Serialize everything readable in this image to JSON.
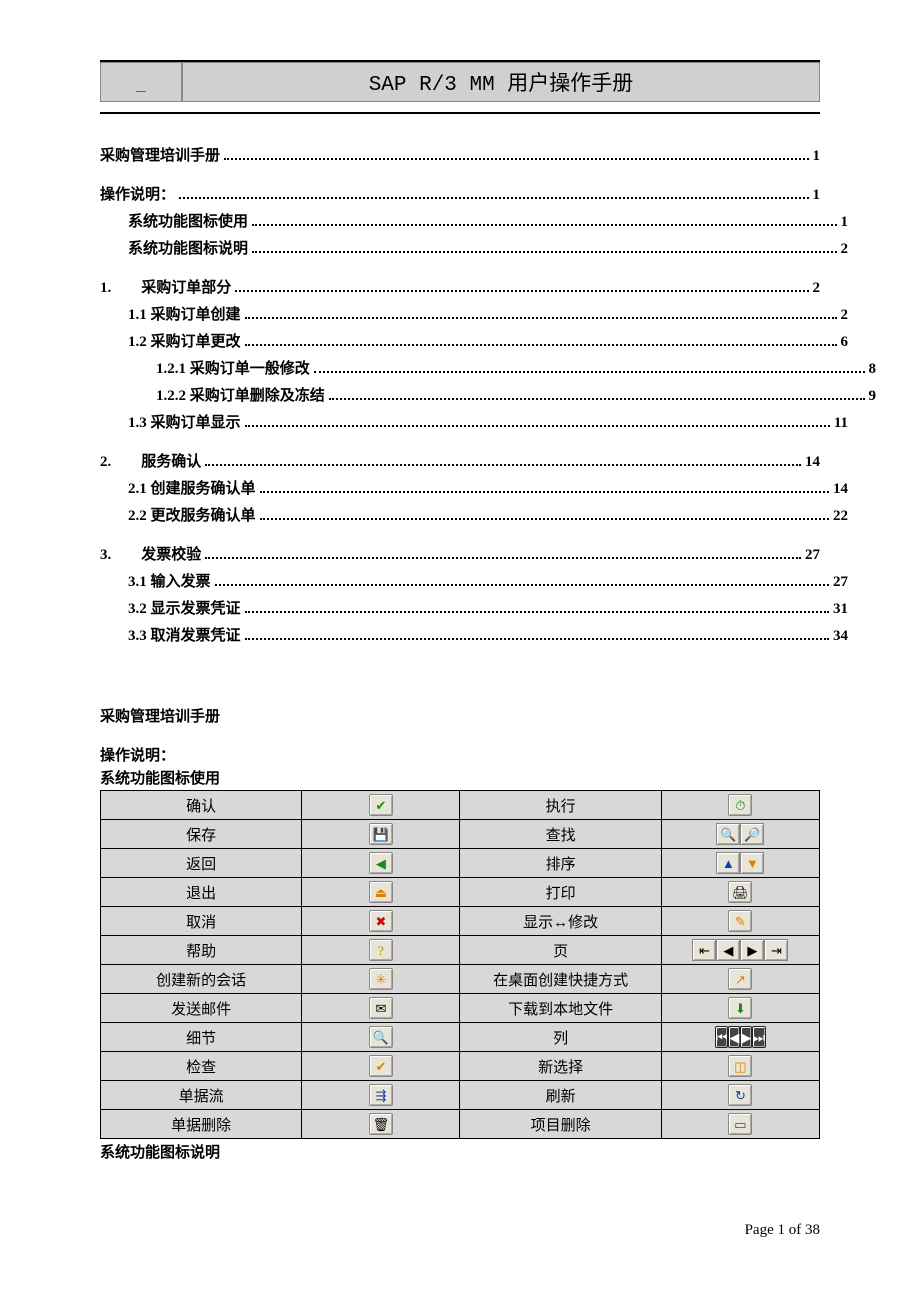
{
  "header": {
    "title": "SAP R/3 MM 用户操作手册"
  },
  "toc": {
    "main": {
      "label": "采购管理培训手册",
      "page": "1"
    },
    "groups": [
      {
        "head": {
          "label": "操作说明：",
          "page": "1"
        },
        "items": [
          {
            "label": "系统功能图标使用",
            "page": "1",
            "indent": 1
          },
          {
            "label": "系统功能图标说明",
            "page": "2",
            "indent": 1
          }
        ]
      },
      {
        "head": {
          "label": "1.　　采购订单部分",
          "page": "2"
        },
        "items": [
          {
            "label": "1.1 采购订单创建",
            "page": "2",
            "indent": 1
          },
          {
            "label": "1.2 采购订单更改",
            "page": "6",
            "indent": 1
          },
          {
            "label": "1.2.1 采购订单一般修改",
            "page": "8",
            "indent": 2
          },
          {
            "label": "1.2.2 采购订单删除及冻结",
            "page": "9",
            "indent": 2
          },
          {
            "label": "1.3 采购订单显示",
            "page": "11",
            "indent": 1
          }
        ]
      },
      {
        "head": {
          "label": "2.　　服务确认",
          "page": "14"
        },
        "items": [
          {
            "label": "2.1 创建服务确认单",
            "page": "14",
            "indent": 1
          },
          {
            "label": "2.2 更改服务确认单",
            "page": "22",
            "indent": 1
          }
        ]
      },
      {
        "head": {
          "label": "3.　　发票校验",
          "page": "27"
        },
        "items": [
          {
            "label": "3.1 输入发票",
            "page": "27",
            "indent": 1
          },
          {
            "label": "3.2 显示发票凭证",
            "page": "31",
            "indent": 1
          },
          {
            "label": "3.3 取消发票凭证",
            "page": "34",
            "indent": 1
          }
        ]
      }
    ]
  },
  "body": {
    "heading1": "采购管理培训手册",
    "heading2": "操作说明：",
    "heading3": "系统功能图标使用",
    "heading4": "系统功能图标说明"
  },
  "iconTable": {
    "rows": [
      {
        "l1": "确认",
        "i1": "check-icon",
        "l2": "执行",
        "i2": "execute-icon"
      },
      {
        "l1": "保存",
        "i1": "save-icon",
        "l2": "查找",
        "i2": "find-icons"
      },
      {
        "l1": "返回",
        "i1": "back-icon",
        "l2": "排序",
        "i2": "sort-icons"
      },
      {
        "l1": "退出",
        "i1": "exit-icon",
        "l2": "打印",
        "i2": "print-icon"
      },
      {
        "l1": "取消",
        "i1": "cancel-icon",
        "l2": "显示↔修改",
        "i2": "display-change-icon"
      },
      {
        "l1": "帮助",
        "i1": "help-icon",
        "l2": "页",
        "i2": "page-nav-icons"
      },
      {
        "l1": "创建新的会话",
        "i1": "new-session-icon",
        "l2": "在桌面创建快捷方式",
        "i2": "shortcut-icon"
      },
      {
        "l1": "发送邮件",
        "i1": "mail-icon",
        "l2": "下载到本地文件",
        "i2": "download-icon"
      },
      {
        "l1": "细节",
        "i1": "detail-icon",
        "l2": "列",
        "i2": "column-nav-icons"
      },
      {
        "l1": "检查",
        "i1": "check-doc-icon",
        "l2": "新选择",
        "i2": "new-selection-icon"
      },
      {
        "l1": "单据流",
        "i1": "doc-flow-icon",
        "l2": "刷新",
        "i2": "refresh-icon"
      },
      {
        "l1": "单据删除",
        "i1": "doc-delete-icon",
        "l2": "项目删除",
        "i2": "item-delete-icon"
      }
    ]
  },
  "footer": {
    "text": "Page 1 of 38"
  }
}
